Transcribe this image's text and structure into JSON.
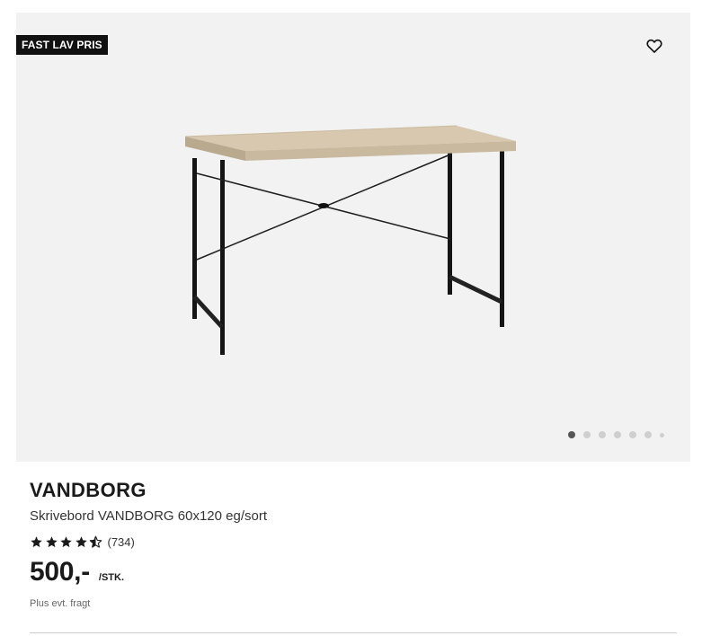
{
  "product": {
    "badge": "FAST LAV PRIS",
    "favorite_icon": "heart-outline-icon",
    "brand": "VANDBORG",
    "subtitle": "Skrivebord VANDBORG 60x120 eg/sort",
    "rating": {
      "stars": 4.5,
      "max": 5,
      "count_label": "(734)"
    },
    "price": "500,-",
    "unit": "/STK.",
    "shipping": "Plus evt. fragt"
  },
  "gallery": {
    "total_images": 7,
    "active_index": 0
  },
  "colors": {
    "badge_bg": "#111111",
    "image_bg": "#f2f2f2",
    "dot_active": "#555555",
    "dot_inactive": "#cfcfcf"
  }
}
